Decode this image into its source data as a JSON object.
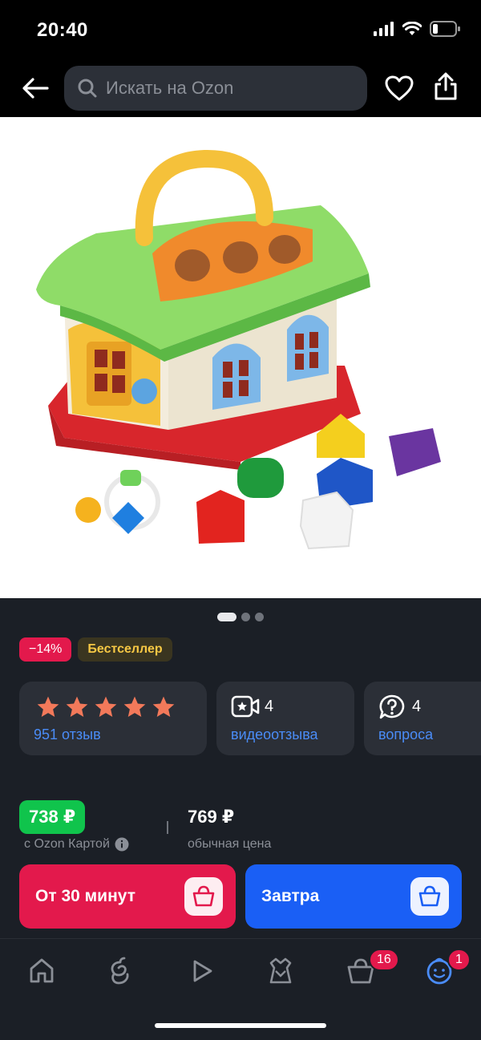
{
  "status_bar": {
    "time": "20:40",
    "icons": [
      "signal-icon",
      "wifi-icon",
      "battery-icon"
    ]
  },
  "top_bar": {
    "search_placeholder": "Искать на Ozon",
    "icons": [
      "back-arrow-icon",
      "search-icon",
      "heart-icon",
      "share-icon"
    ]
  },
  "gallery": {
    "image_subject": "toy sorter house with shapes",
    "slides": 3,
    "active_slide": 1
  },
  "badges": {
    "discount": "−14%",
    "bestseller": "Бестселлер"
  },
  "reviews": {
    "stars": 5,
    "reviews_label": "951 отзыв",
    "video_count": "4",
    "video_label": "видеоотзыва",
    "questions_count": "4",
    "questions_label": "вопроса"
  },
  "price": {
    "card_price": "738 ₽",
    "card_price_label": "с Ozon Картой",
    "regular_price": "769 ₽",
    "regular_price_label": "обычная цена"
  },
  "delivery": {
    "fast_label": "От 30 минут",
    "tomorrow_label": "Завтра"
  },
  "bottom_nav": {
    "items": [
      "home-icon",
      "ozon-fresh-icon",
      "video-icon",
      "fashion-icon",
      "cart-icon",
      "profile-icon"
    ],
    "cart_badge": "16",
    "profile_badge": "1"
  },
  "colors": {
    "accent_red": "#e3194c",
    "accent_blue": "#1a5ff5",
    "price_green": "#10c44c",
    "link_blue": "#4a8cf7",
    "star_orange": "#f2795a",
    "bestseller_yellow": "#f6c744"
  }
}
